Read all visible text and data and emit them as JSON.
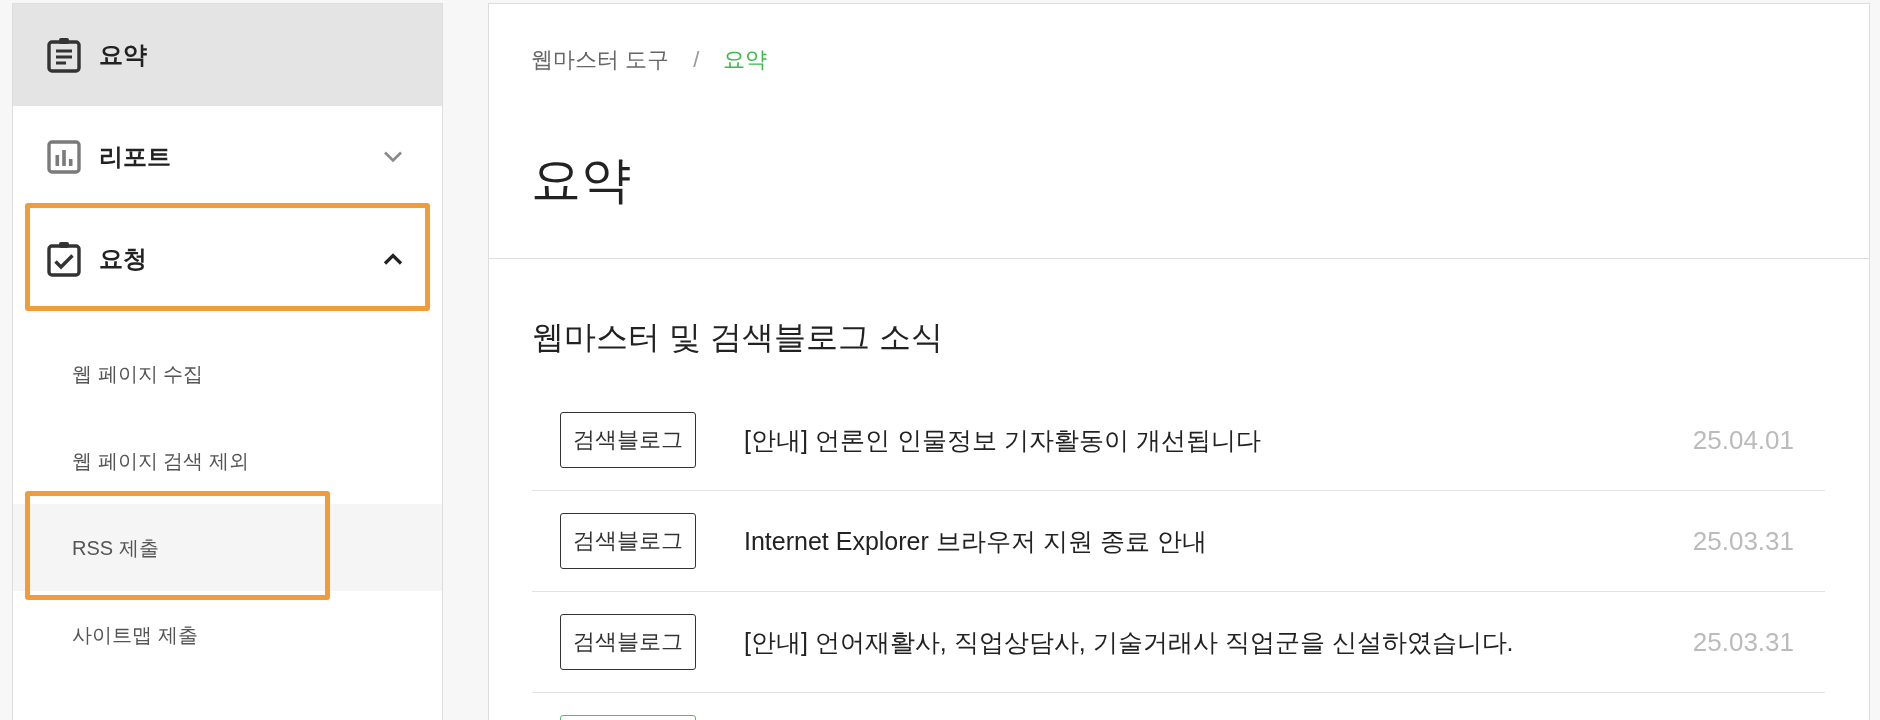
{
  "sidebar": {
    "items": [
      {
        "kind": "link",
        "label": "요약",
        "selected": true,
        "highlighted": false
      },
      {
        "kind": "group",
        "label": "리포트",
        "selected": false,
        "expanded": false,
        "highlighted": false
      },
      {
        "kind": "group",
        "label": "요청",
        "selected": false,
        "expanded": true,
        "highlighted": true,
        "children": [
          {
            "label": "웹 페이지 수집",
            "selected": false,
            "highlighted": false
          },
          {
            "label": "웹 페이지 검색 제외",
            "selected": false,
            "highlighted": false
          },
          {
            "label": "RSS 제출",
            "selected": true,
            "highlighted": true
          },
          {
            "label": "사이트맵 제출",
            "selected": false,
            "highlighted": false
          }
        ]
      }
    ]
  },
  "breadcrumb": {
    "separator": "/",
    "items": [
      {
        "label": "웹마스터 도구",
        "selected": false
      },
      {
        "label": "요약",
        "selected": true
      }
    ]
  },
  "page_title": "요약",
  "news": {
    "title": "웹마스터 및 검색블로그 소식",
    "rows": [
      {
        "tag": "검색블로그",
        "color": "#333333",
        "title": "[안내] 언론인 인물정보 기자활동이 개선됩니다",
        "date": "25.04.01"
      },
      {
        "tag": "검색블로그",
        "color": "#333333",
        "title": "Internet Explorer 브라우저 지원 종료 안내",
        "date": "25.03.31"
      },
      {
        "tag": "검색블로그",
        "color": "#333333",
        "title": "[안내] 언어재활사, 직업상담사, 기술거래사 직업군을 신설하였습니다.",
        "date": "25.03.31"
      },
      {
        "color": "#4cc25c"
      }
    ]
  }
}
